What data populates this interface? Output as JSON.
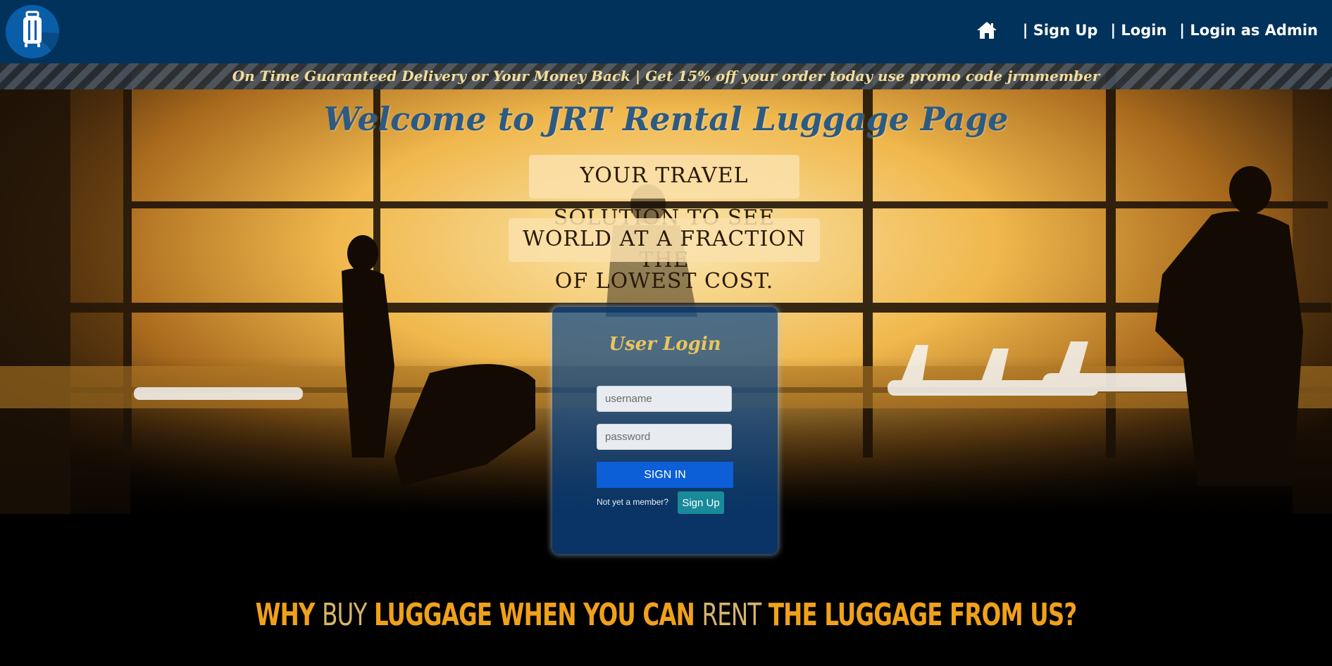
{
  "nav": {
    "logo_icon": "suitcase-icon",
    "home_icon": "home-icon",
    "links": [
      {
        "label": "| Sign Up"
      },
      {
        "label": "| Login"
      },
      {
        "label": "| Login as Admin"
      }
    ]
  },
  "promo": {
    "text": "On Time Guaranteed Delivery or Your Money Back | Get 15% off your order today use promo code jrmmember"
  },
  "hero": {
    "title": "Welcome to JRT Rental Luggage Page",
    "tagline_line1": "YOUR TRAVEL SOLUTION TO SEE THE",
    "tagline_line2": "WORLD AT A FRACTION OF LOWEST COST."
  },
  "login": {
    "title": "User Login",
    "username_placeholder": "username",
    "password_placeholder": "password",
    "signin_label": "SIGN IN",
    "member_text": "Not yet a member?",
    "signup_label": "Sign Up"
  },
  "footer_tagline": {
    "part1": "WHY ",
    "part2": "BUY",
    "part3": " LUGGAGE WHEN YOU CAN ",
    "part4": "RENT",
    "part5": " THE LUGGAGE FROM US?"
  },
  "colors": {
    "navbar": "#01325b",
    "accent_gold": "#f0a11a",
    "button_blue": "#0c5fd6",
    "signup_teal": "#188a9a"
  }
}
